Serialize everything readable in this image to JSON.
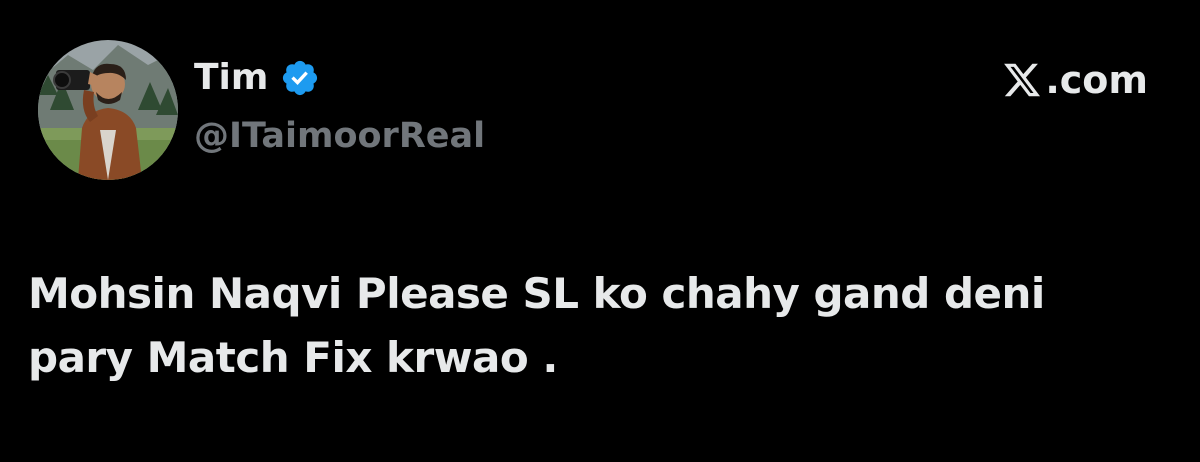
{
  "author": {
    "display_name": "Tim",
    "handle": "@ITaimoorReal",
    "verified": true
  },
  "brand": {
    "label": ".com"
  },
  "tweet": {
    "text": "Mohsin Naqvi Please SL ko chahy gand deni\npary Match Fix krwao ."
  },
  "icons": {
    "verified": "verified-badge-icon",
    "brand_logo": "x-logo-icon"
  },
  "colors": {
    "background": "#000000",
    "primary_text": "#e7e9ea",
    "secondary_text": "#71767b",
    "verified_blue": "#1d9bf0"
  }
}
